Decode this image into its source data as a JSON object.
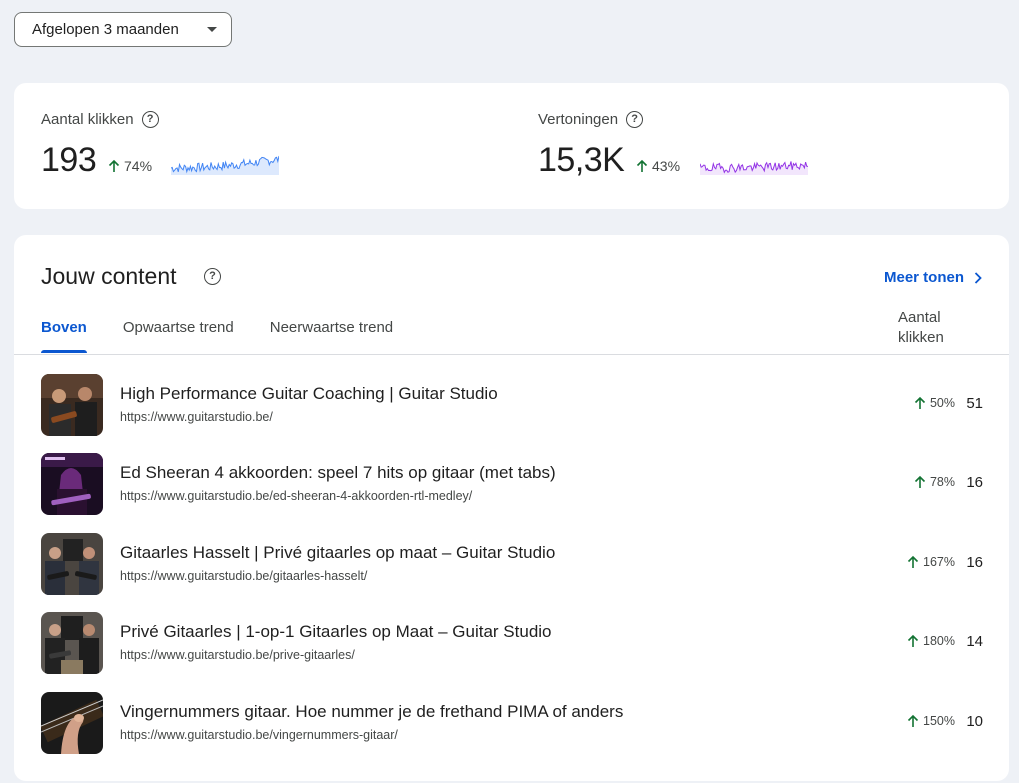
{
  "date_range": {
    "selected": "Afgelopen 3 maanden"
  },
  "metrics": [
    {
      "label": "Aantal klikken",
      "value": "193",
      "change": "74%",
      "color": "#4285f4"
    },
    {
      "label": "Vertoningen",
      "value": "15,3K",
      "change": "43%",
      "color": "#9334e6"
    }
  ],
  "content": {
    "title": "Jouw content",
    "more_link": "Meer tonen",
    "tabs": [
      "Boven",
      "Opwaartse trend",
      "Neerwaartse trend"
    ],
    "active_tab": "Boven",
    "column_header_line1": "Aantal",
    "column_header_line2": "klikken",
    "rows": [
      {
        "title": "High Performance Guitar Coaching | Guitar Studio",
        "url": "https://www.guitarstudio.be/",
        "change": "50%",
        "clicks": "51"
      },
      {
        "title": "Ed Sheeran 4 akkoorden: speel 7 hits op gitaar (met tabs)",
        "url": "https://www.guitarstudio.be/ed-sheeran-4-akkoorden-rtl-medley/",
        "change": "78%",
        "clicks": "16"
      },
      {
        "title": "Gitaarles Hasselt | Privé gitaarles op maat – Guitar Studio",
        "url": "https://www.guitarstudio.be/gitaarles-hasselt/",
        "change": "167%",
        "clicks": "16"
      },
      {
        "title": "Privé Gitaarles | 1-op-1 Gitaarles op Maat – Guitar Studio",
        "url": "https://www.guitarstudio.be/prive-gitaarles/",
        "change": "180%",
        "clicks": "14"
      },
      {
        "title": "Vingernummers gitaar. Hoe nummer je de frethand PIMA of anders",
        "url": "https://www.guitarstudio.be/vingernummers-gitaar/",
        "change": "150%",
        "clicks": "10"
      }
    ]
  },
  "colors": {
    "accent": "#0b57d0",
    "up_arrow": "#137333"
  }
}
